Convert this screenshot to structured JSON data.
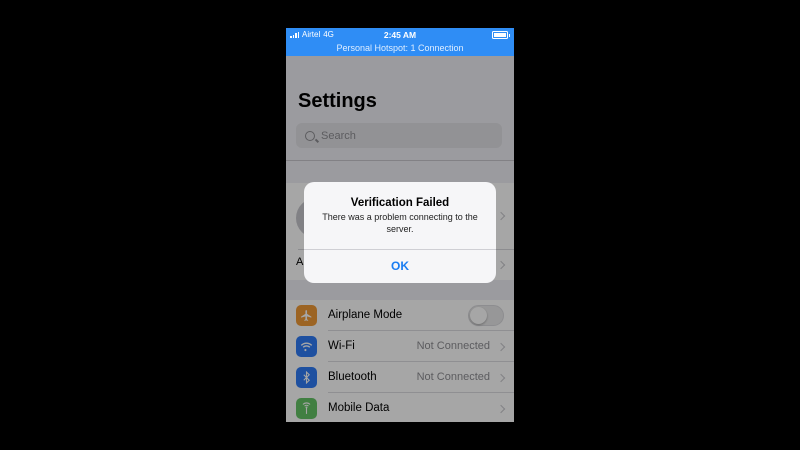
{
  "status_bar": {
    "carrier": "Airtel",
    "network": "4G",
    "time": "2:45 AM",
    "banner": "Personal Hotspot: 1 Connection"
  },
  "header": {
    "title": "Settings",
    "search_placeholder": "Search"
  },
  "profile": {
    "second_row_label": "A"
  },
  "settings_list": [
    {
      "label": "Airplane Mode",
      "icon": "airplane-icon",
      "color": "#f09a37",
      "value": "",
      "control": "toggle",
      "toggle_on": false
    },
    {
      "label": "Wi-Fi",
      "icon": "wifi-icon",
      "color": "#2f7cf6",
      "value": "Not Connected",
      "control": "chevron"
    },
    {
      "label": "Bluetooth",
      "icon": "bluetooth-icon",
      "color": "#2f7cf6",
      "value": "Not Connected",
      "control": "chevron"
    },
    {
      "label": "Mobile Data",
      "icon": "antenna-icon",
      "color": "#65c466",
      "value": "",
      "control": "chevron"
    }
  ],
  "alert": {
    "title": "Verification Failed",
    "message": "There was a problem connecting to the server.",
    "button_label": "OK"
  },
  "colors": {
    "status_bar": "#2f8df5",
    "accent": "#1a7df2",
    "background": "#efeff4"
  }
}
